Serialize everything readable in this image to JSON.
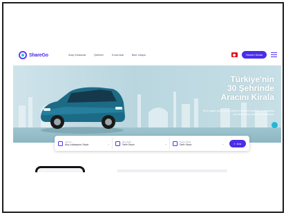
{
  "brand": {
    "name": "ShareGo",
    "accent": "#4a2ee8",
    "secondary": "#25c2d6"
  },
  "nav": {
    "links": [
      "Araç Kiralama",
      "Şehirler",
      "Kurumsal",
      "Bize Ulaşın"
    ],
    "language_flag": "tr-flag-icon",
    "cta_label": "Hemen Kirala",
    "menu_icon": "menu-icon"
  },
  "hero": {
    "title_lines": [
      "Türkiye'nin",
      "30 Şehrinde",
      "Aracını Kirala"
    ],
    "subtitle": "Size uygun aracı seçin, teslim noktasını belirleyin ve kiralama sürecini birkaç adımda tamamlayın."
  },
  "search": {
    "fields": [
      {
        "label": "Konum",
        "value": "Alış Lokasyonu Seçin"
      },
      {
        "label": "Alış Tarihi",
        "value": "Tarih Seçin"
      },
      {
        "label": "Teslim Tarihi",
        "value": "Tarih Seçin"
      }
    ],
    "button_label": "Ara"
  },
  "chat": {
    "icon": "chat-icon"
  }
}
